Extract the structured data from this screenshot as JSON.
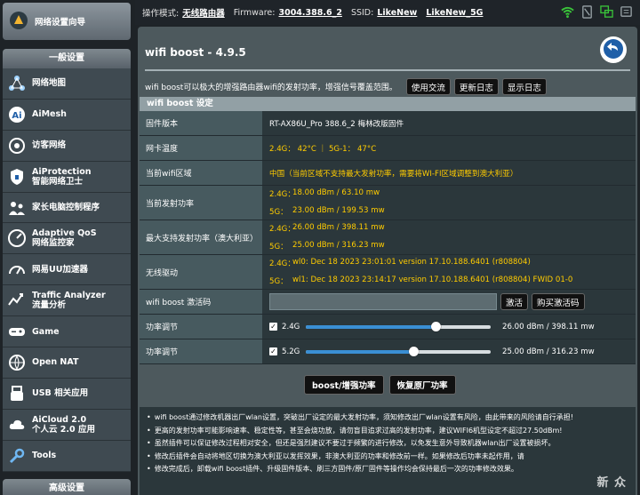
{
  "topbar": {
    "mode_label": "操作模式:",
    "mode_value": "无线路由器",
    "fw_label": "Firmware:",
    "fw_value": "3004.388.6_2",
    "ssid_label": "SSID:",
    "ssid_1": "LikeNew",
    "ssid_2": "LikeNew_5G"
  },
  "sidebar": {
    "wizard": "网络设置向导",
    "general_title": "一般设置",
    "items": [
      {
        "label": "网络地图",
        "icon": "network-map-icon"
      },
      {
        "label": "AiMesh",
        "icon": "aimesh-icon"
      },
      {
        "label": "访客网络",
        "icon": "guest-network-icon"
      },
      {
        "label": "AiProtection\n智能网络卫士",
        "icon": "shield-icon"
      },
      {
        "label": "家长电脑控制程序",
        "icon": "parental-control-icon"
      },
      {
        "label": "Adaptive QoS\n网络监控家",
        "icon": "qos-icon"
      },
      {
        "label": "网易UU加速器",
        "icon": "speedometer-icon"
      },
      {
        "label": "Traffic Analyzer\n流量分析",
        "icon": "traffic-analyzer-icon"
      },
      {
        "label": "Game",
        "icon": "gamepad-icon"
      },
      {
        "label": "Open NAT",
        "icon": "open-nat-icon"
      },
      {
        "label": "USB 相关应用",
        "icon": "usb-icon"
      },
      {
        "label": "AiCloud 2.0\n个人云 2.0 应用",
        "icon": "cloud-icon"
      },
      {
        "label": "Tools",
        "icon": "wrench-icon"
      }
    ],
    "advanced_title": "高级设置"
  },
  "main": {
    "title": "wifi boost - 4.9.5",
    "intro": "wifi boost可以极大的增强路由器wifi的发射功率，增强信号覆盖范围。",
    "buttons": {
      "discuss": "使用交流",
      "changelog": "更新日志",
      "showlog": "显示日志"
    },
    "section_title": "wifi boost 设定",
    "rows": {
      "firmware": {
        "label": "固件版本",
        "value": "RT-AX86U_Pro  388.6_2  梅林改版固件"
      },
      "temp": {
        "label": "网卡温度",
        "value": "2.4G： 42°C  ｜  5G-1： 47°C"
      },
      "region": {
        "label": "当前wifi区域",
        "value": "中国（当前区域不支持最大发射功率，需要将WI-FI区域调整到澳大利亚）"
      },
      "tx_power": {
        "label": "当前发射功率",
        "l1": "2.4G：",
        "v1": "18.00 dBm / 63.10 mw",
        "l2": "5G：",
        "v2": "23.00 dBm / 199.53 mw"
      },
      "max_power": {
        "label": "最大支持发射功率（澳大利亚）",
        "l1": "2.4G：",
        "v1": "26.00 dBm / 398.11 mw",
        "l2": "5G：",
        "v2": "25.00 dBm / 316.23 mw"
      },
      "driver": {
        "label": "无线驱动",
        "l1": "2.4G：",
        "v1": "wl0: Dec 18 2023 23:01:01 version 17.10.188.6401 (r808804)",
        "l2": "5G：",
        "v2": "wl1: Dec 18 2023 23:14:17 version 17.10.188.6401 (r808804) FWID 01-0"
      },
      "activation": {
        "label": "wifi boost 激活码",
        "activate": "激活",
        "buy": "购买激活码"
      },
      "power24": {
        "label": "功率调节",
        "band": "2.4G",
        "value": "26.00 dBm / 398.11 mw",
        "level": 0.7
      },
      "power5": {
        "label": "功率调节",
        "band": "5.2G",
        "value": "25.00 dBm / 316.23 mw",
        "level": 0.58
      }
    },
    "actions": {
      "boost": "boost/增强功率",
      "restore": "恢复原厂功率"
    },
    "notes": [
      "wifi boost通过修改机器出厂wlan设置，突破出厂设定的最大发射功率，须知修改出厂wlan设置有风险，由此带来的风险请自行承担!",
      "更高的发射功率可能影响速率、稳定性等，甚至会烧功放，请勿盲目追求过高的发射功率，建议WIFI6机型设定不超过27.50dBm!",
      "虽然插件可以保证修改过程相对安全，但还是强烈建议不要过于频繁的进行修改，以免发生意外导致机器wlan出厂设置被损坏。",
      "修改后插件会自动将地区切换为澳大利亚以发挥效果，非澳大利亚的功率和修改前一样。如果修改后功率未起作用，请",
      "修改完成后，卸载wifi boost插件、升级固件版本、刷三方固件/原厂固件等操作均会保持最后一次的功率修改效果。"
    ],
    "watermark": "新 众"
  }
}
